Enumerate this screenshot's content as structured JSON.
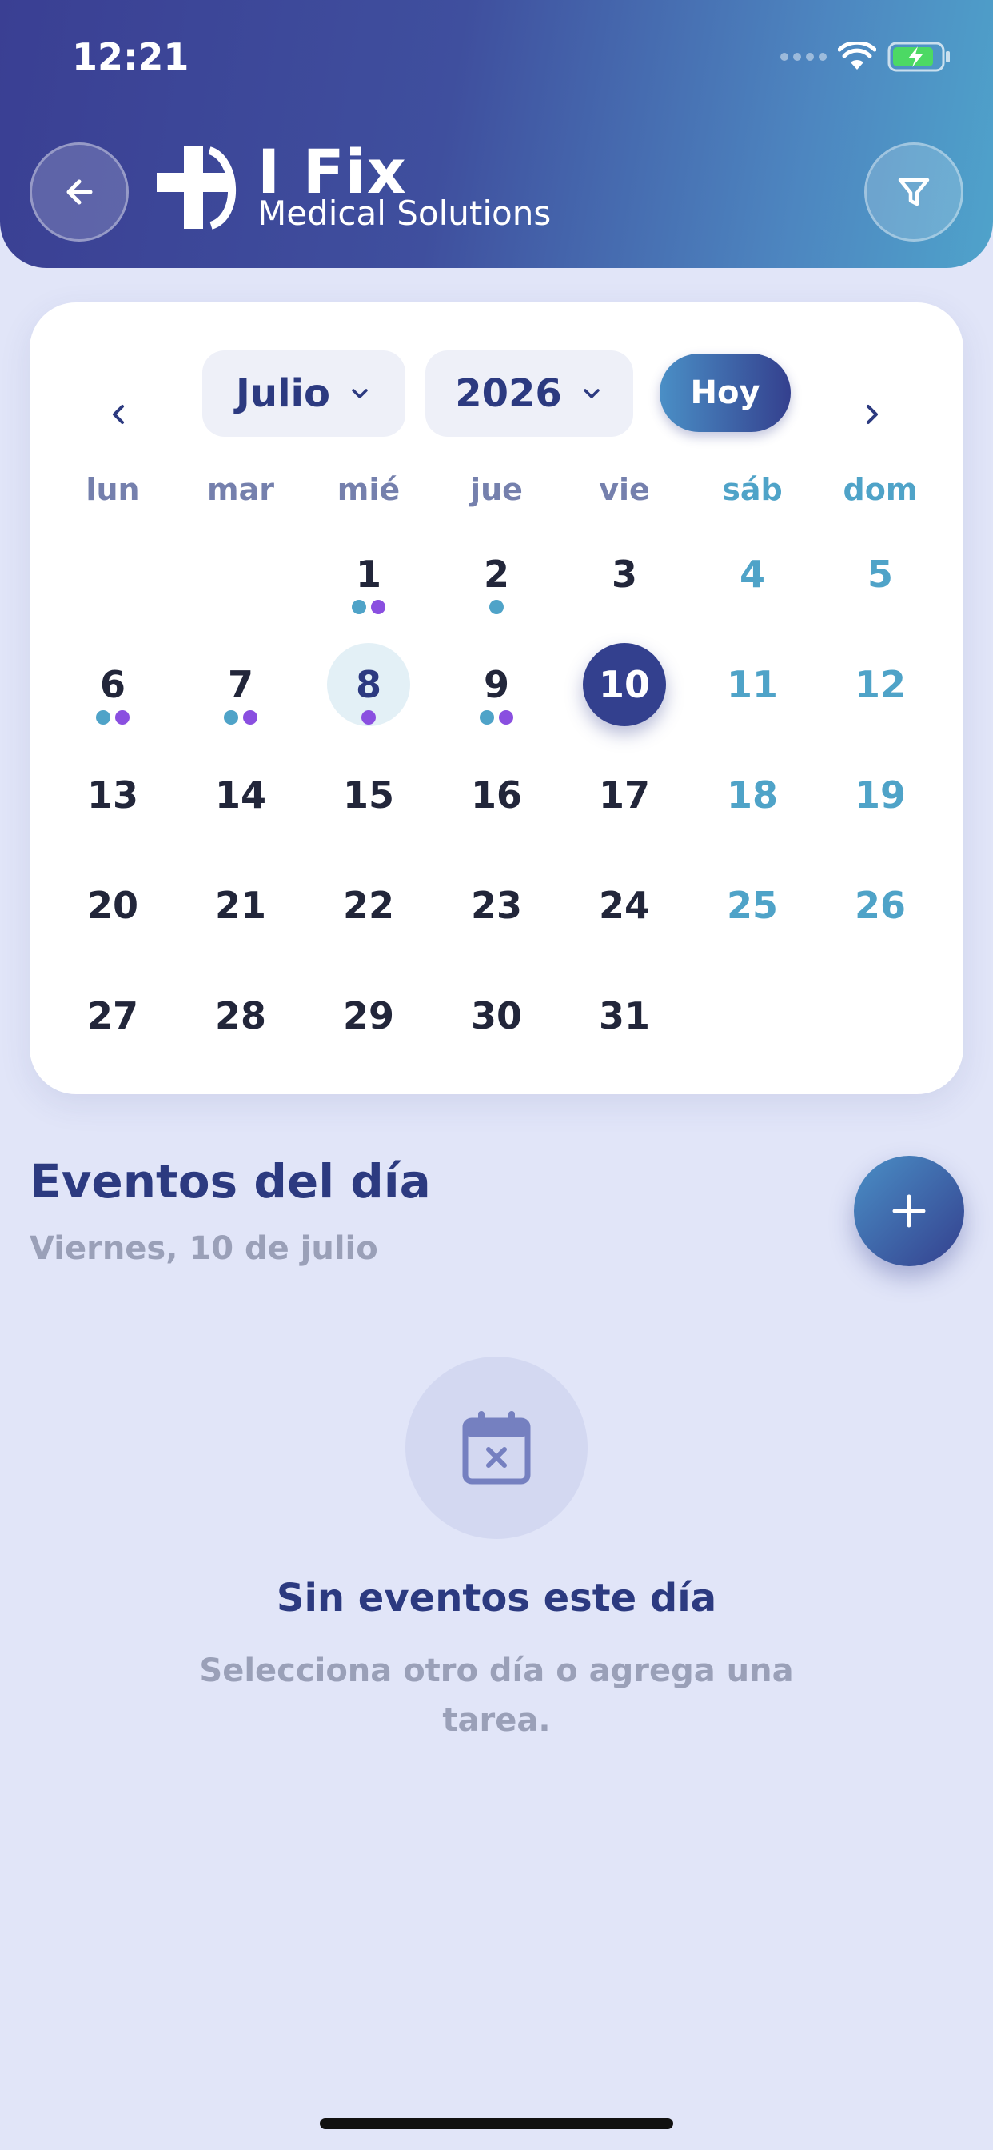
{
  "status_bar": {
    "time": "12:21"
  },
  "header": {
    "logo_title": "I Fix",
    "logo_subtitle": "Medical Solutions"
  },
  "calendar": {
    "month_label": "Julio",
    "year_label": "2026",
    "today_label": "Hoy",
    "weekdays": [
      "lun",
      "mar",
      "mié",
      "jue",
      "vie",
      "sáb",
      "dom"
    ],
    "days": [
      {
        "label": "1",
        "dots": [
          "#4fa3c8",
          "#8a4fe0"
        ]
      },
      {
        "label": "2",
        "dots": [
          "#4fa3c8"
        ]
      },
      {
        "label": "3",
        "dots": []
      },
      {
        "label": "4",
        "dots": []
      },
      {
        "label": "5",
        "dots": []
      },
      {
        "label": "6",
        "dots": [
          "#4fa3c8",
          "#8a4fe0"
        ]
      },
      {
        "label": "7",
        "dots": [
          "#4fa3c8",
          "#8a4fe0"
        ]
      },
      {
        "label": "8",
        "dots": [
          "#8a4fe0"
        ],
        "state": "today"
      },
      {
        "label": "9",
        "dots": [
          "#4fa3c8",
          "#8a4fe0"
        ]
      },
      {
        "label": "10",
        "dots": [],
        "state": "selected"
      },
      {
        "label": "11",
        "dots": []
      },
      {
        "label": "12",
        "dots": []
      },
      {
        "label": "13",
        "dots": []
      },
      {
        "label": "14",
        "dots": []
      },
      {
        "label": "15",
        "dots": []
      },
      {
        "label": "16",
        "dots": []
      },
      {
        "label": "17",
        "dots": []
      },
      {
        "label": "18",
        "dots": []
      },
      {
        "label": "19",
        "dots": []
      },
      {
        "label": "20",
        "dots": []
      },
      {
        "label": "21",
        "dots": []
      },
      {
        "label": "22",
        "dots": []
      },
      {
        "label": "23",
        "dots": []
      },
      {
        "label": "24",
        "dots": []
      },
      {
        "label": "25",
        "dots": []
      },
      {
        "label": "26",
        "dots": []
      },
      {
        "label": "27",
        "dots": []
      },
      {
        "label": "28",
        "dots": []
      },
      {
        "label": "29",
        "dots": []
      },
      {
        "label": "30",
        "dots": []
      },
      {
        "label": "31",
        "dots": []
      }
    ]
  },
  "events": {
    "title": "Eventos del día",
    "date_label": "Viernes, 10 de julio",
    "empty_title": "Sin eventos este día",
    "empty_subtitle": "Selecciona otro día o agrega una tarea."
  },
  "colors": {
    "accent": "#33408e",
    "weekend": "#4fa3c8",
    "dot_blue": "#4fa3c8",
    "dot_purple": "#8a4fe0"
  }
}
